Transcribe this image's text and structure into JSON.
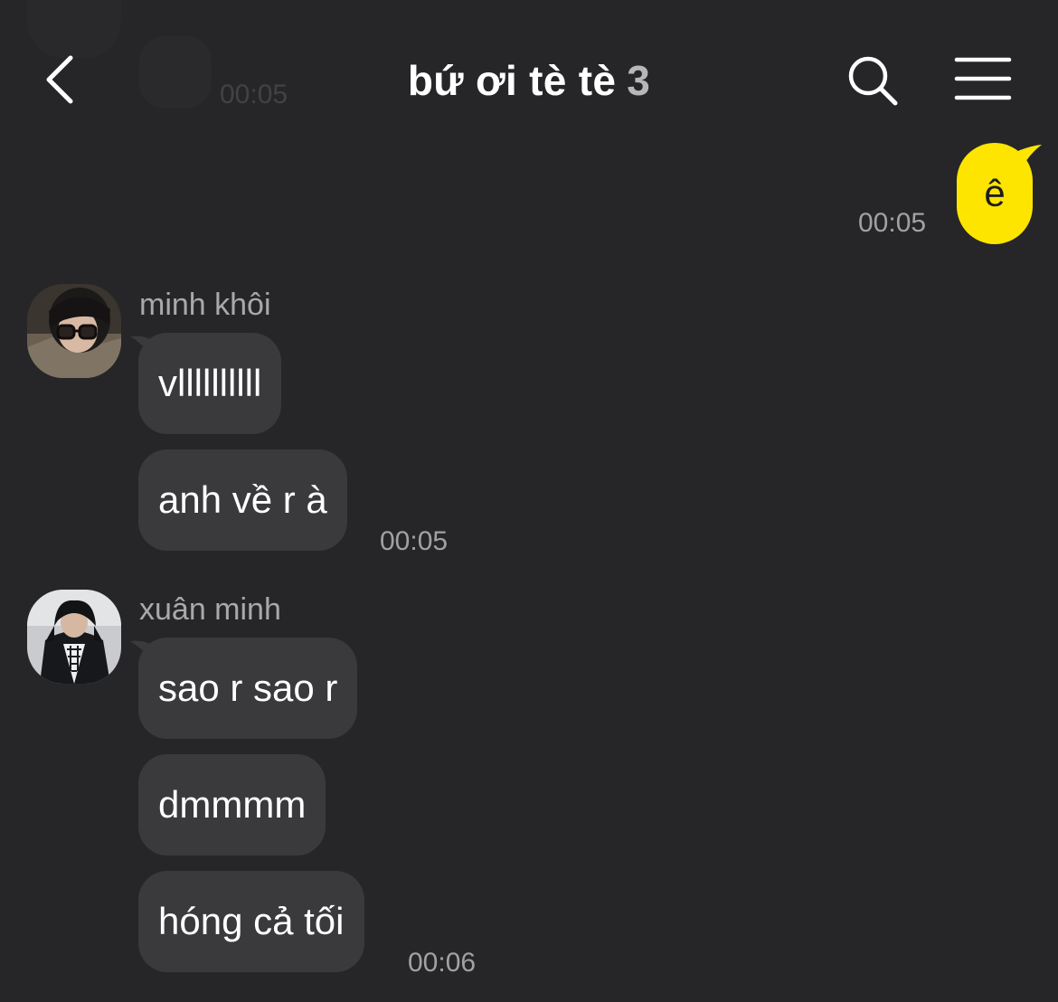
{
  "header": {
    "title": "bứ ơi tè tè",
    "member_count": "3",
    "icons": {
      "back": "chevron-left-icon",
      "search": "search-icon",
      "menu": "hamburger-menu-icon"
    }
  },
  "colors": {
    "background": "#262628",
    "outgoing_bubble": "#fee500",
    "incoming_bubble": "#3a3a3d",
    "timestamp": "#a1a1a4"
  },
  "ghost": {
    "time": "00:05"
  },
  "messages": {
    "outgoing": [
      {
        "text": "ê",
        "time": "00:05"
      }
    ],
    "groups": [
      {
        "sender": "minh khôi",
        "bubbles": [
          "vllllllllll",
          "anh về r à"
        ],
        "time": "00:05"
      },
      {
        "sender": "xuân minh",
        "bubbles": [
          "sao r sao r",
          "dmmmm",
          "hóng cả tối"
        ],
        "time": "00:06"
      }
    ]
  }
}
